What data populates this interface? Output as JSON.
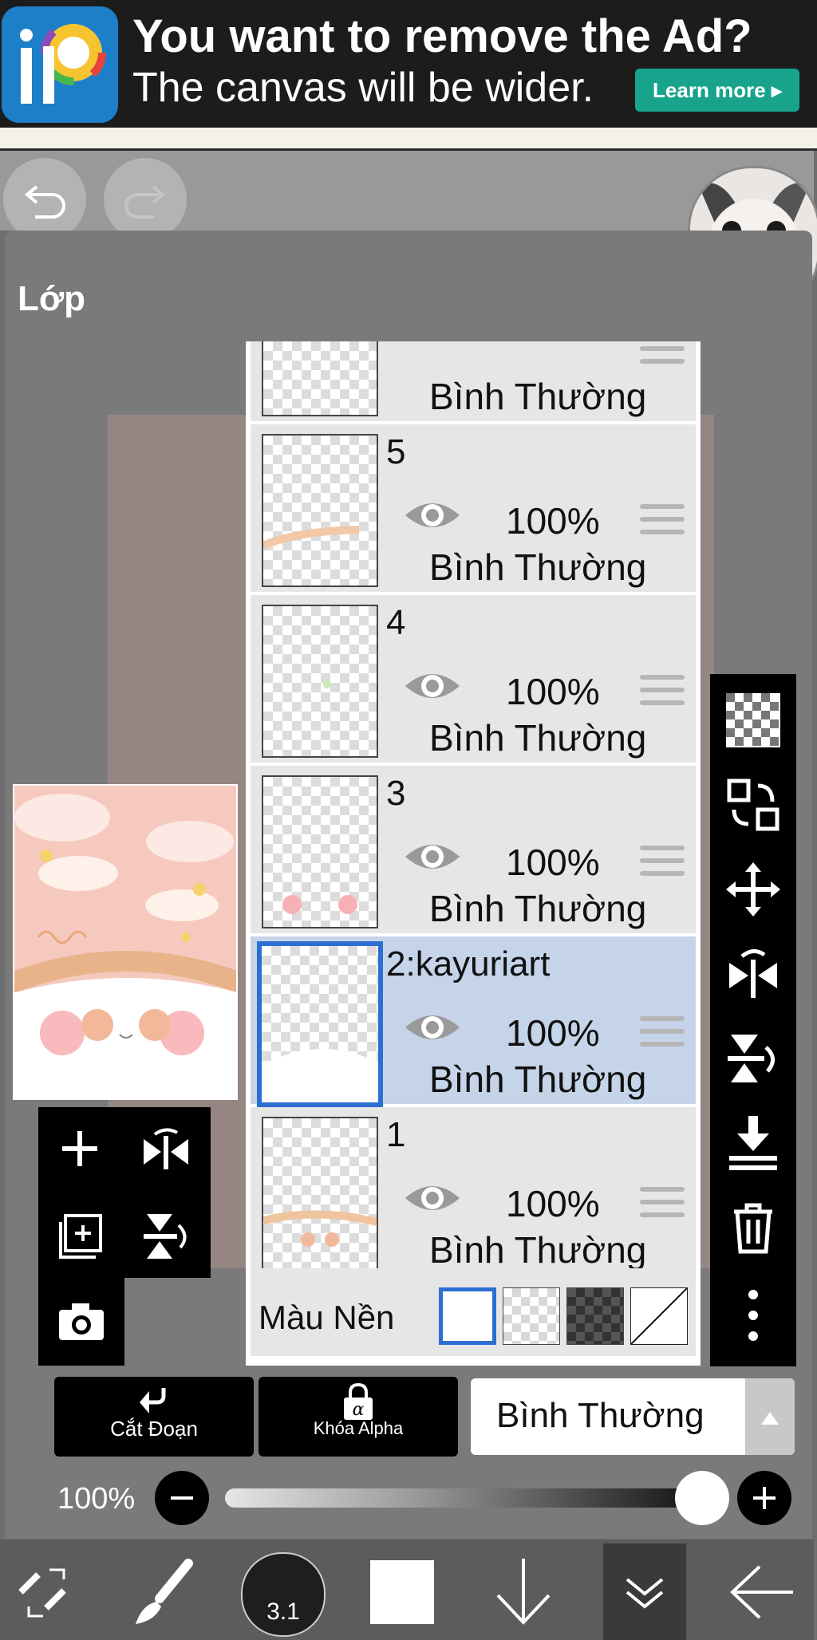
{
  "ad": {
    "title": "You want to remove the Ad?",
    "subtitle": "The canvas will be wider.",
    "button": "Learn more ▸"
  },
  "panel": {
    "title": "Lớp"
  },
  "layers": [
    {
      "name": "",
      "opacity": "",
      "blend": "Bình Thường"
    },
    {
      "name": "5",
      "opacity": "100%",
      "blend": "Bình Thường"
    },
    {
      "name": "4",
      "opacity": "100%",
      "blend": "Bình Thường"
    },
    {
      "name": "3",
      "opacity": "100%",
      "blend": "Bình Thường"
    },
    {
      "name": "2:kayuriart",
      "opacity": "100%",
      "blend": "Bình Thường",
      "selected": true
    },
    {
      "name": "1",
      "opacity": "100%",
      "blend": "Bình Thường"
    }
  ],
  "background_color": {
    "label": "Màu Nền"
  },
  "controls": {
    "clipping_label": "Cắt Đoạn",
    "alpha_lock_label": "Khóa Alpha",
    "blend_mode": "Bình Thường",
    "layer_opacity": "100%"
  },
  "bottom_toolbar": {
    "brush_size": "3.1"
  },
  "colors": {
    "accent": "#2d6fd1",
    "selected_row": "#c6d4ea",
    "ad_button": "#18a38d"
  }
}
